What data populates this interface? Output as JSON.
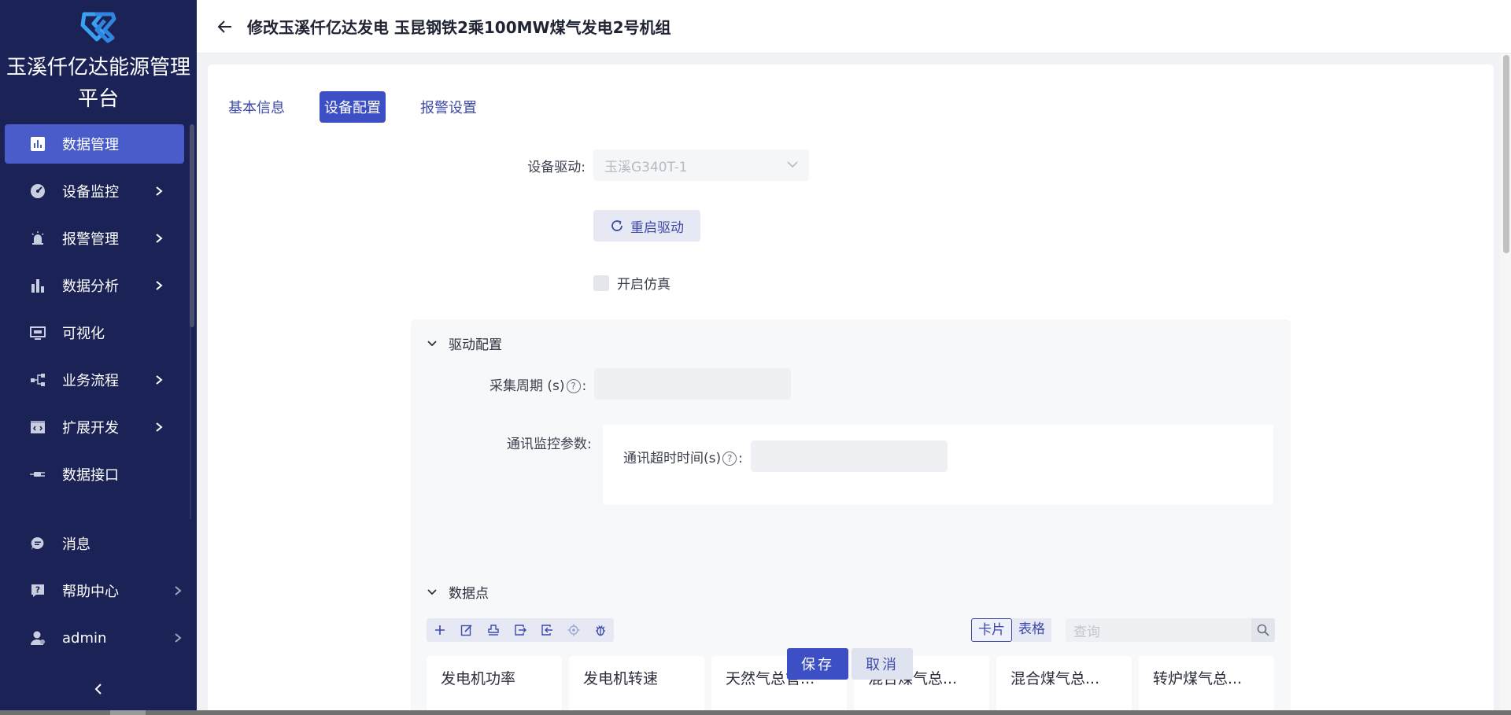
{
  "sidebar": {
    "brand_line1": "玉溪仟亿达能源管理",
    "brand_line2": "平台",
    "items": [
      {
        "label": "数据管理",
        "icon": "bar-chart-box-icon",
        "active": true,
        "has_arrow": false
      },
      {
        "label": "设备监控",
        "icon": "monitor-gauge-icon",
        "active": false,
        "has_arrow": true
      },
      {
        "label": "报警管理",
        "icon": "alarm-siren-icon",
        "active": false,
        "has_arrow": true
      },
      {
        "label": "数据分析",
        "icon": "bar-stats-icon",
        "active": false,
        "has_arrow": true
      },
      {
        "label": "可视化",
        "icon": "screen-icon",
        "active": false,
        "has_arrow": false
      },
      {
        "label": "业务流程",
        "icon": "flow-icon",
        "active": false,
        "has_arrow": true
      },
      {
        "label": "扩展开发",
        "icon": "code-window-icon",
        "active": false,
        "has_arrow": true
      },
      {
        "label": "数据接口",
        "icon": "plug-icon",
        "active": false,
        "has_arrow": false
      }
    ],
    "bottom_items": [
      {
        "label": "消息",
        "icon": "chat-bubble-icon",
        "has_arrow": false
      },
      {
        "label": "帮助中心",
        "icon": "help-box-icon",
        "has_arrow": true
      },
      {
        "label": "admin",
        "icon": "user-icon",
        "has_arrow": true
      }
    ]
  },
  "header": {
    "title": "修改玉溪仟亿达发电 玉昆钢铁2乘100MW煤气发电2号机组"
  },
  "tabs": [
    {
      "label": "基本信息",
      "active": false
    },
    {
      "label": "设备配置",
      "active": true
    },
    {
      "label": "报警设置",
      "active": false
    }
  ],
  "device": {
    "driver_label": "设备驱动:",
    "driver_value": "玉溪G340T-1",
    "restart_label": "重启驱动",
    "simulate_label": "开启仿真",
    "simulate_checked": false
  },
  "driver_config": {
    "title": "驱动配置",
    "period_label": "采集周期 (s)",
    "period_suffix": ":",
    "period_value": "",
    "comm_label": "通讯监控参数:",
    "timeout_label": "通讯超时时间(s)",
    "timeout_suffix": ":",
    "timeout_value": ""
  },
  "data_points": {
    "title": "数据点",
    "toolbar": [
      "add-icon",
      "edit-icon",
      "stamp-icon",
      "import-icon",
      "export-icon",
      "locate-icon",
      "debug-bug-icon"
    ],
    "view_card": "卡片",
    "view_table": "表格",
    "search_placeholder": "查询",
    "cards": [
      "发电机功率",
      "发电机转速",
      "天然气总管...",
      "混合煤气总...",
      "混合煤气总...",
      "转炉煤气总..."
    ]
  },
  "footer": {
    "save": "保存",
    "cancel": "取消"
  },
  "colors": {
    "sidebar_bg": "#1b2356",
    "accent": "#3d4fc4",
    "active_menu": "#4a5cc9"
  }
}
